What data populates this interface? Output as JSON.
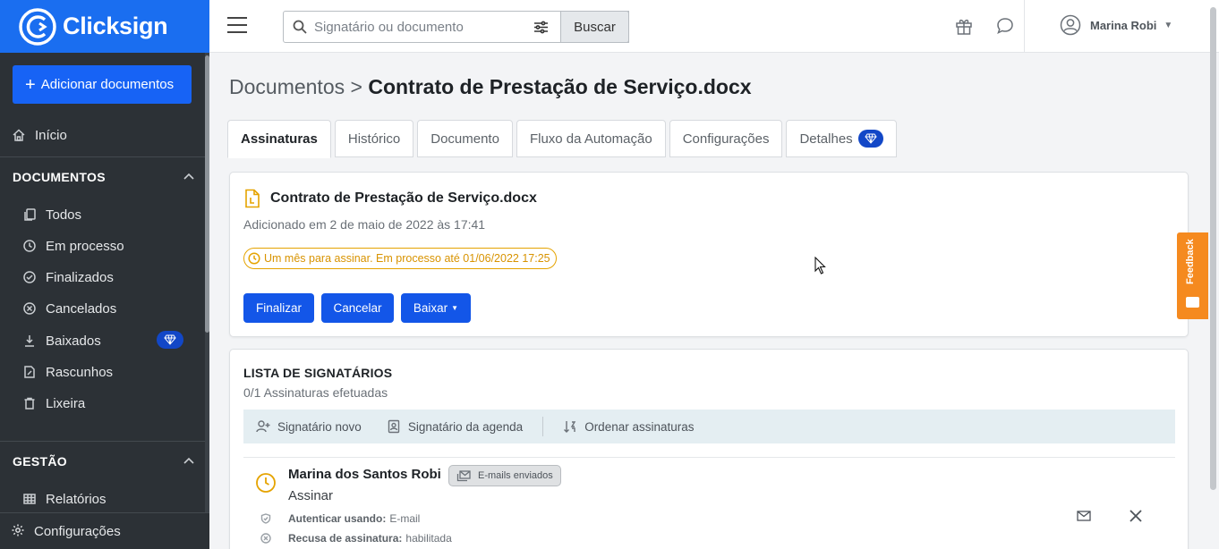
{
  "brand": {
    "name": "Clicksign",
    "color": "#1a6ef0"
  },
  "sidebar": {
    "add_button": "Adicionar documentos",
    "home": "Início",
    "documents_section": "DOCUMENTOS",
    "doc_items": [
      {
        "label": "Todos",
        "icon": "copy-icon"
      },
      {
        "label": "Em processo",
        "icon": "clock-icon"
      },
      {
        "label": "Finalizados",
        "icon": "check-circle-icon"
      },
      {
        "label": "Cancelados",
        "icon": "x-circle-icon"
      },
      {
        "label": "Baixados",
        "icon": "download-icon"
      },
      {
        "label": "Rascunhos",
        "icon": "draft-icon"
      },
      {
        "label": "Lixeira",
        "icon": "trash-icon"
      }
    ],
    "management_section": "GESTÃO",
    "reports": "Relatórios",
    "settings": "Configurações"
  },
  "header": {
    "search_placeholder": "Signatário ou documento",
    "search_button": "Buscar",
    "user_name": "Marina Robi"
  },
  "page": {
    "breadcrumb_root": "Documentos",
    "breadcrumb_sep": ">",
    "title": "Contrato de Prestação de Serviço.docx",
    "tabs": [
      "Assinaturas",
      "Histórico",
      "Documento",
      "Fluxo da Automação",
      "Configurações",
      "Detalhes"
    ]
  },
  "document": {
    "name": "Contrato de Prestação de Serviço.docx",
    "added": "Adicionado em 2 de maio de 2022 às 17:41",
    "deadline": "Um mês para assinar. Em processo até 01/06/2022 17:25",
    "buttons": {
      "finalize": "Finalizar",
      "cancel": "Cancelar",
      "download": "Baixar"
    }
  },
  "signers": {
    "title": "LISTA DE SIGNATÁRIOS",
    "count": "0/1 Assinaturas efetuadas",
    "toolbar": [
      "Signatário novo",
      "Signatário da agenda",
      "Ordenar assinaturas"
    ],
    "rows": [
      {
        "name": "Marina dos Santos Robi",
        "badge": "E-mails enviados",
        "action": "Assinar",
        "auth_label": "Autenticar usando:",
        "auth_value": "E-mail",
        "refuse_label": "Recusa de assinatura:",
        "refuse_value": "habilitada"
      }
    ]
  },
  "feedback": "Feedback",
  "colors": {
    "primary": "#1356e8",
    "warning": "#e5a300",
    "feedback": "#f58a1f",
    "premium": "#1247c7"
  }
}
